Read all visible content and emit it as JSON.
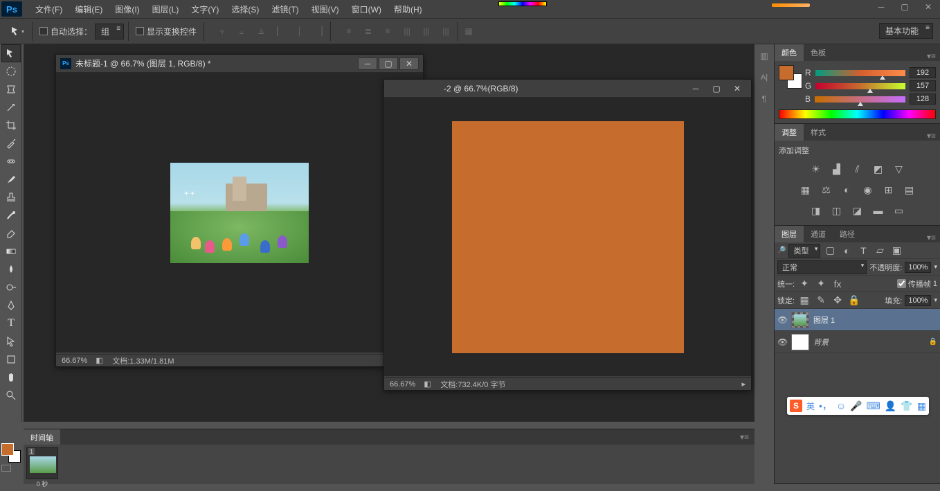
{
  "app": {
    "name": "Ps"
  },
  "menu": {
    "items": [
      "文件(F)",
      "编辑(E)",
      "图像(I)",
      "图层(L)",
      "文字(Y)",
      "选择(S)",
      "滤镜(T)",
      "视图(V)",
      "窗口(W)",
      "帮助(H)"
    ]
  },
  "options": {
    "auto_select_label": "自动选择：",
    "auto_select_value": "组",
    "show_transform_label": "显示变换控件",
    "workspace": "基本功能"
  },
  "doc1": {
    "title": "未标题-1 @ 66.7% (图层 1, RGB/8) *",
    "zoom": "66.67%",
    "status": "文档:1.33M/1.81M"
  },
  "doc2": {
    "title": "-2 @ 66.7%(RGB/8)",
    "zoom": "66.67%",
    "status": "文档:732.4K/0 字节"
  },
  "panels": {
    "color_tab": "颜色",
    "swatch_tab": "色板",
    "adjust_tab": "调整",
    "style_tab": "样式",
    "add_adjust": "添加调整",
    "layers_tab": "图层",
    "channels_tab": "通道",
    "paths_tab": "路径"
  },
  "color": {
    "r_label": "R",
    "r_val": "192",
    "g_label": "G",
    "g_val": "157",
    "b_label": "B",
    "b_val": "128",
    "fg": "#c66d2e"
  },
  "layers": {
    "filter_label": "类型",
    "blend_mode": "正常",
    "opacity_label": "不透明度:",
    "opacity_val": "100%",
    "unify_label": "统一:",
    "propagate_label": "传播帧",
    "propagate_val": "1",
    "lock_label": "锁定:",
    "fill_label": "填充:",
    "fill_val": "100%",
    "layer1": "图层 1",
    "background": "背景"
  },
  "timeline": {
    "tab": "时间轴",
    "frame_num": "1",
    "duration": "0 秒"
  },
  "ime": {
    "lang": "英"
  }
}
